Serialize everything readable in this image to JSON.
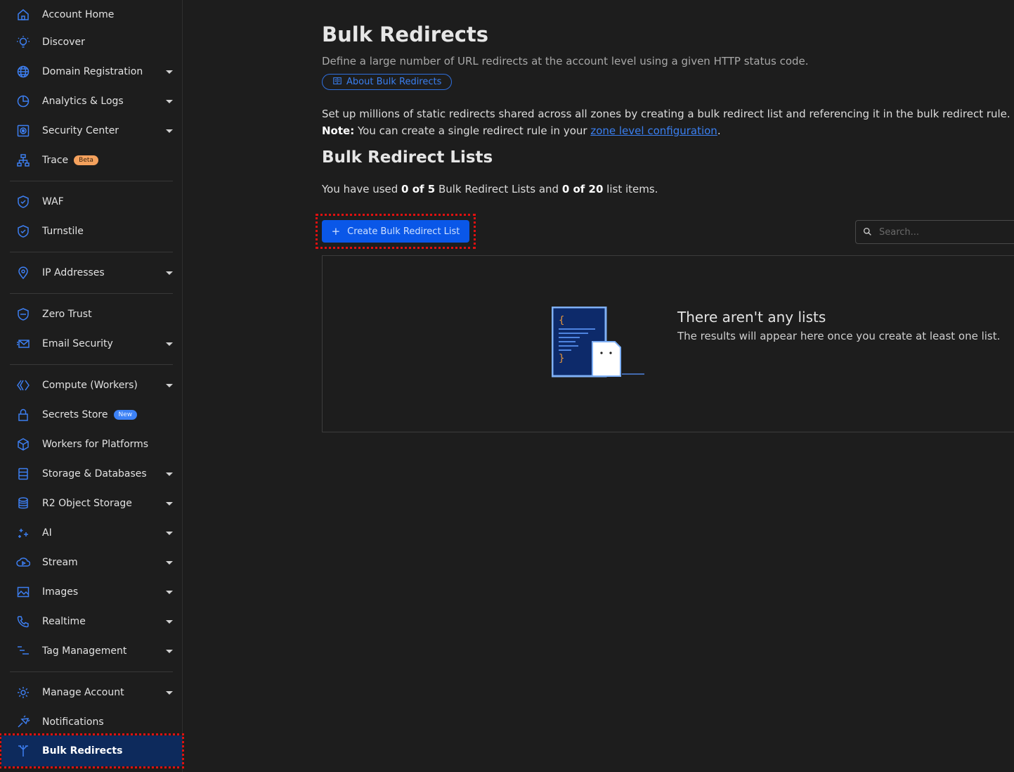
{
  "sidebar": {
    "items": [
      {
        "label": "Account Home",
        "icon": "home-icon"
      },
      {
        "label": "Discover",
        "icon": "lightbulb-icon"
      },
      {
        "label": "Domain Registration",
        "icon": "globe-icon"
      },
      {
        "label": "Analytics & Logs",
        "icon": "pie-chart-icon"
      },
      {
        "label": "Security Center",
        "icon": "security-center-icon"
      },
      {
        "label": "Trace",
        "icon": "trace-icon",
        "badge": "Beta"
      },
      {
        "label": "WAF",
        "icon": "waf-shield-icon"
      },
      {
        "label": "Turnstile",
        "icon": "turnstile-icon"
      },
      {
        "label": "IP Addresses",
        "icon": "location-pin-icon"
      },
      {
        "label": "Zero Trust",
        "icon": "zero-trust-icon"
      },
      {
        "label": "Email Security",
        "icon": "email-icon"
      },
      {
        "label": "Compute (Workers)",
        "icon": "workers-icon"
      },
      {
        "label": "Secrets Store",
        "icon": "lock-icon",
        "badge": "New"
      },
      {
        "label": "Workers for Platforms",
        "icon": "cube-icon"
      },
      {
        "label": "Storage & Databases",
        "icon": "database-icon"
      },
      {
        "label": "R2 Object Storage",
        "icon": "storage-icon"
      },
      {
        "label": "AI",
        "icon": "sparkles-icon"
      },
      {
        "label": "Stream",
        "icon": "stream-icon"
      },
      {
        "label": "Images",
        "icon": "image-icon"
      },
      {
        "label": "Realtime",
        "icon": "phone-icon"
      },
      {
        "label": "Tag Management",
        "icon": "tag-management-icon"
      },
      {
        "label": "Manage Account",
        "icon": "gear-icon"
      },
      {
        "label": "Notifications",
        "icon": "notifications-icon"
      },
      {
        "label": "Bulk Redirects",
        "icon": "bulk-redirects-icon"
      }
    ]
  },
  "main": {
    "title": "Bulk Redirects",
    "subtitle": "Define a large number of URL redirects at the account level using a given HTTP status code.",
    "about_label": "About Bulk Redirects",
    "intro_line1": "Set up millions of static redirects shared across all zones by creating a bulk redirect list and referencing it in the bulk redirect rule.",
    "note_label": "Note:",
    "note_text": " You can create a single redirect rule in your ",
    "note_link": "zone level configuration",
    "note_end": ".",
    "lists_title": "Bulk Redirect Lists",
    "usage_prefix": "You have used ",
    "usage_lists": "0 of 5",
    "usage_mid": " Bulk Redirect Lists and ",
    "usage_items": "0 of 20",
    "usage_suffix": " list items.",
    "create_label": "Create Bulk Redirect List",
    "search_placeholder": "Search...",
    "empty_title": "There aren't any lists",
    "empty_text": "The results will appear here once you create at least one list."
  },
  "colors": {
    "accent": "#0a57e8",
    "link": "#3a7ff0",
    "active_bg": "#0d2a5c",
    "highlight": "#e01010"
  }
}
